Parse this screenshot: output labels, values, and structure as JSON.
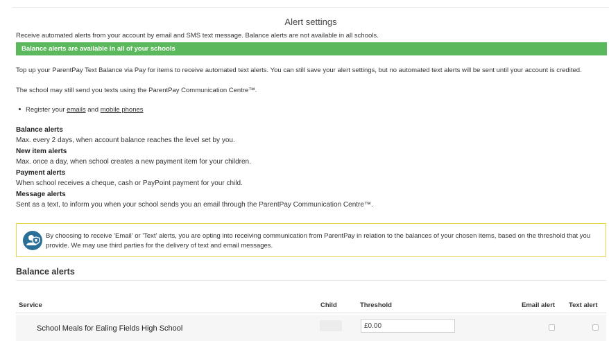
{
  "page": {
    "title": "Alert settings",
    "intro": "Receive automated alerts from your account by email and SMS text message. Balance alerts are not available in all schools.",
    "banner": "Balance alerts are available in all of your schools",
    "paragraph1": "Top up your ParentPay Text Balance via Pay for items to receive automated text alerts. You can still save your alert settings, but no automated text alerts will be sent until your account is credited.",
    "paragraph2": "The school may still send you texts using the ParentPay Communication Centre™.",
    "register": {
      "prefix": "Register your ",
      "emails_link": "emails",
      "middle": " and ",
      "phones_link": "mobile phones"
    }
  },
  "alert_types": [
    {
      "heading": "Balance alerts",
      "description": "Max. every 2 days, when account balance reaches the level set by you."
    },
    {
      "heading": "New item alerts",
      "description": "Max. once a day, when school creates a new payment item for your children."
    },
    {
      "heading": "Payment alerts",
      "description": "When school receives a cheque, cash or PayPoint payment for your child."
    },
    {
      "heading": "Message alerts",
      "description": "Sent as a text, to inform you when your school sends you an email through the ParentPay Communication Centre™."
    }
  ],
  "notice": {
    "icon": "user-shield-icon",
    "text": "By choosing to receive 'Email' or 'Text' alerts, you are opting into receiving communication from ParentPay in relation to the balances of your chosen items, based on the threshold that you provide. We may use third parties for the delivery of text and email messages.",
    "border_color": "#e8d54a",
    "icon_color": "#2a6f97"
  },
  "balance_alerts": {
    "section_title": "Balance alerts",
    "columns": {
      "service": "Service",
      "child": "Child",
      "threshold": "Threshold",
      "email_alert": "Email alert",
      "text_alert": "Text alert"
    },
    "rows": [
      {
        "service": "School Meals for Ealing Fields High School",
        "threshold_value": "£0.00",
        "email_alert": false,
        "text_alert": false
      }
    ]
  },
  "colors": {
    "banner_bg": "#5cb85c",
    "text": "#333333"
  }
}
